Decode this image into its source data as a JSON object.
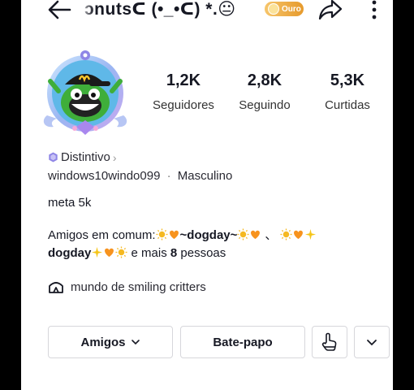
{
  "header": {
    "username_display": "ɔnutsᑕ (•_•ᑕ) *.😐",
    "tier_label": "Ouro",
    "icons": [
      "back-arrow-icon",
      "share-icon",
      "more-icon"
    ]
  },
  "stats": [
    {
      "value": "1,2K",
      "label": "Seguidores"
    },
    {
      "value": "2,8K",
      "label": "Seguindo"
    },
    {
      "value": "5,3K",
      "label": "Curtidas"
    }
  ],
  "badge": {
    "label": "Distintivo",
    "chevron": "›"
  },
  "profile": {
    "handle": "windows10windo099",
    "separator": "·",
    "gender": "Masculino",
    "bio": "meta 5k"
  },
  "mutual": {
    "prefix": "Amigos em comum:",
    "friend1": "~dogday~",
    "sep": "、",
    "friend2": "dogday",
    "and_more": "e mais",
    "count": "8",
    "suffix": "pessoas"
  },
  "community": {
    "label": "mundo de smiling critters"
  },
  "actions": {
    "friends": "Amigos",
    "chat": "Bate-papo"
  },
  "colors": {
    "text": "#161823",
    "tier_gold": "#e69a2c",
    "orange_heart": "#f7931e",
    "sun": "#f5b921",
    "badge_purple": "#8f86e6"
  }
}
